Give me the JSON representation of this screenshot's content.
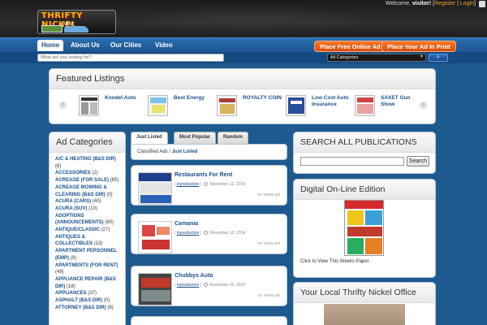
{
  "header": {
    "logo_text": "THRIFTY NICKEL",
    "logo_sub": "WANT",
    "welcome_prefix": "Welcome, ",
    "user": "visitor!",
    "register": "Register",
    "login": "Login",
    "sep1": " | ",
    "sep2": " | ",
    "bracket_open": "[",
    "bracket_close": "]"
  },
  "nav": {
    "items": [
      "Home",
      "About Us",
      "Our Cities",
      "Video"
    ],
    "cta_online": "Place Free Online Ad",
    "cta_print": "Place Your Ad In Print"
  },
  "search": {
    "placeholder": "What are you looking for?",
    "category": "All Categories",
    "button": "⌕"
  },
  "featured": {
    "title": "Featured Listings",
    "items": [
      {
        "name": "Knodel Auto"
      },
      {
        "name": "Best Energy"
      },
      {
        "name": "ROYALTY COIN"
      },
      {
        "name": "Low Cost Auto Insurance"
      },
      {
        "name": "SAXET Gun Show"
      }
    ]
  },
  "sidebar": {
    "title": "Ad Categories",
    "items": [
      {
        "label": "A/C & HEATING (B&S DIR)",
        "count": "(6)"
      },
      {
        "label": "ACCESSORIES",
        "count": "(2)"
      },
      {
        "label": "ACREAGE (FOR SALE)",
        "count": "(85)"
      },
      {
        "label": "ACREAGE MOWING & CLEARING (B&S DIR)",
        "count": "(0)"
      },
      {
        "label": "ACURA (CARS)",
        "count": "(40)"
      },
      {
        "label": "ACURA (SUV)",
        "count": "(10)"
      },
      {
        "label": "ADOPTIONS (ANNOUNCEMENTS)",
        "count": "(60)"
      },
      {
        "label": "ANTIQUE/CLASSIC",
        "count": "(27)"
      },
      {
        "label": "ANTIQUES & COLLECTIBLES",
        "count": "(13)"
      },
      {
        "label": "APARTMENT PERSONNEL (EMP)",
        "count": "(9)"
      },
      {
        "label": "APARTMENTS (FOR RENT)",
        "count": "(49)"
      },
      {
        "label": "APPLIANCE REPAIR (B&S DIR)",
        "count": "(18)"
      },
      {
        "label": "APPLIANCES",
        "count": "(37)"
      },
      {
        "label": "ASPHALT (B&S DIR)",
        "count": "(0)"
      },
      {
        "label": "ATTORNEY (B&S DIR)",
        "count": "(6)"
      }
    ]
  },
  "tabs": [
    "Just Listed",
    "Most Popular",
    "Random"
  ],
  "breadcrumb": {
    "root": "Classified Ads",
    "sep": " / ",
    "current": "Just Listed"
  },
  "listings": [
    {
      "title": "Restaurants For Rent",
      "category": "Inproduction",
      "date": "November 12, 2014",
      "views": "no views yet"
    },
    {
      "title": "Camania",
      "category": "Inproduction",
      "date": "November 12, 2014",
      "views": "no views yet"
    },
    {
      "title": "Chubbys Auto",
      "category": "Inproduction",
      "date": "November 12, 2014",
      "views": "no views yet"
    }
  ],
  "right": {
    "search_title": "SEARCH ALL PUBLICATIONS",
    "search_button": "Search",
    "digital_title": "Digital On-Line Edition",
    "digital_caption": "Click to View This Weeks Paper",
    "office_title": "Your Local Thrifty Nickel Office"
  },
  "colors": {
    "accent_blue": "#1e5a8e",
    "cta_orange": "#e8611a",
    "link": "#1b4f8c"
  }
}
